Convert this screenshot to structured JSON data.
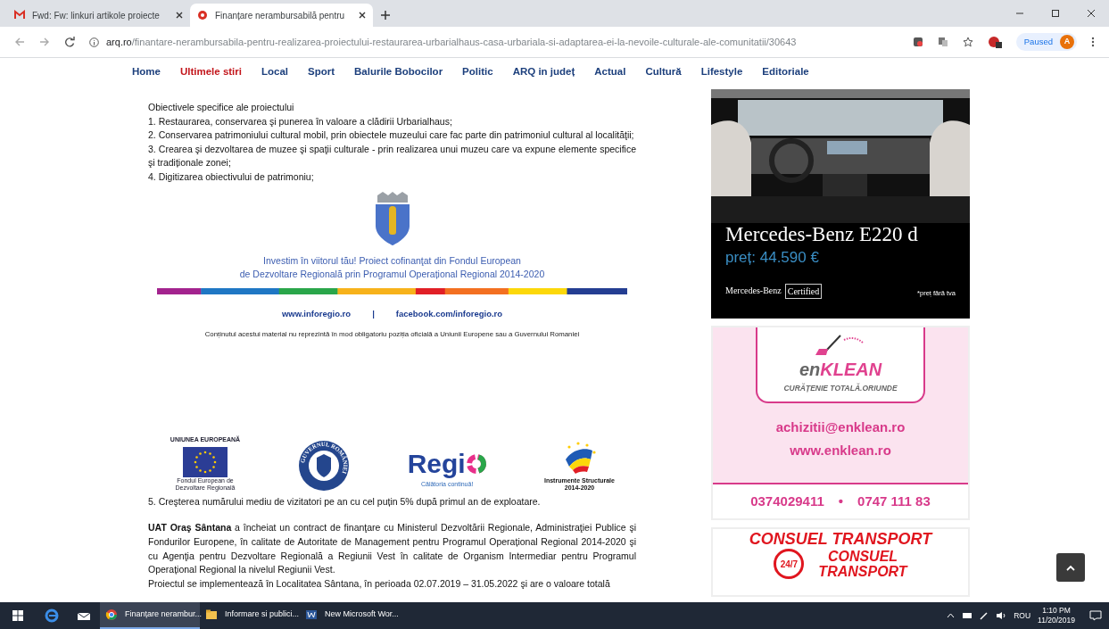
{
  "browser": {
    "tabs": [
      {
        "title": "Fwd: Fw: linkuri artikole proiecte",
        "kind": "mail",
        "selected": false
      },
      {
        "title": "Finanțare nerambursabilă pentru",
        "kind": "site",
        "selected": true
      }
    ],
    "url_host": "arq.ro",
    "url_path": "/finantare-nerambursabila-pentru-realizarea-proiectului-restaurarea-urbarialhaus-casa-urbariala-si-adaptarea-ei-la-nevoile-culturale-ale-comunitatii/30643",
    "profile_status": "Paused",
    "avatar_letter": "A"
  },
  "nav": [
    {
      "label": "Home",
      "selected": false
    },
    {
      "label": "Ultimele stiri",
      "selected": true
    },
    {
      "label": "Local",
      "selected": false
    },
    {
      "label": "Sport",
      "selected": false
    },
    {
      "label": "Balurile Bobocilor",
      "selected": false
    },
    {
      "label": "Politic",
      "selected": false
    },
    {
      "label": "ARQ in județ",
      "selected": false
    },
    {
      "label": "Actual",
      "selected": false
    },
    {
      "label": "Cultură",
      "selected": false
    },
    {
      "label": "Lifestyle",
      "selected": false
    },
    {
      "label": "Editoriale",
      "selected": false
    }
  ],
  "article": {
    "objectives_heading": "Obiectivele specifice ale proiectului",
    "objectives": [
      "1. Restaurarea, conservarea şi punerea în valoare a clădirii Urbarialhaus;",
      "2. Conservarea patrimoniului cultural mobil, prin obiectele muzeului care fac parte din patrimoniul cultural al localităţii;",
      "3. Crearea şi dezvoltarea de muzee şi spaţii culturale - prin realizarea unui muzeu care va expune elemente specifice şi tradiționale zonei;",
      "4. Digitizarea obiectivului de patrimoniu;"
    ],
    "banner": {
      "lines": [
        "Investim în viitorul tău! Proiect cofinanţat din Fondul European",
        "de Dezvoltare Regională prin Programul Operațional Regional 2014-2020"
      ],
      "links": [
        "www.inforegio.ro",
        "facebook.com/inforegio.ro"
      ],
      "separator": "|",
      "disclaimer": "Conținutul acestui material nu reprezintă în mod obligatoriu poziția oficială a Uniunii Europene sau a Guvernului Romaniei"
    },
    "logos": {
      "eu_top": "UNIUNEA EUROPEANĂ",
      "eu_bottom": "Fondul European de Dezvoltare Regională",
      "gov_ring": "GUVERNUL ROMÂNIEI",
      "regio": "Regi",
      "regio_tagline": "Călătoria continuă!",
      "is_title": "Instrumente Structurale",
      "is_years": "2014-2020"
    },
    "item5": "5. Creşterea numărului mediu de vizitatori pe an cu cel puțin 5% după primul an de exploatare.",
    "paragraphs": [
      "**UAT Oraş Sântana** a încheiat un contract de finanţare cu Ministerul Dezvoltării Regionale, Administraţiei Publice şi Fondurilor Europene, în calitate de Autoritate de Management pentru Programul Operațional Regional 2014-2020 şi cu Agenţia pentru Dezvoltare Regională a Regiunii Vest în calitate de Organism Intermediar pentru Programul Operațional Regional la nivelul Regiunii Vest.",
      "Proiectul se implementează în Localitatea Sântana, în perioada 02.07.2019 – 31.05.2022 şi are o valoare totală"
    ]
  },
  "ads": {
    "car": {
      "model": "Mercedes-Benz E220 d",
      "price": "preț: 44.590 €",
      "brand": "Mercedes-Benz",
      "brand_tag": "Certified",
      "note": "*preț fără tva"
    },
    "cleaning": {
      "logo_parts": [
        "en",
        "KLEAN"
      ],
      "tagline": "CURĂȚENIE TOTALĂ.ORIUNDE",
      "email": "achizitii@enklean.ro",
      "web": "www.enklean.ro",
      "phones": [
        "0374029411",
        "0747 111 83"
      ],
      "separator": "•"
    },
    "transport": {
      "heading": "CONSUEL TRANSPORT",
      "badge": "24/7",
      "lines": [
        "CONSUEL",
        "TRANSPORT"
      ]
    }
  },
  "taskbar": {
    "apps": [
      {
        "label": "Finanțare nerambur...",
        "kind": "chrome",
        "selected": true
      },
      {
        "label": "Informare si publici...",
        "kind": "folder",
        "selected": false
      },
      {
        "label": "New Microsoft Wor...",
        "kind": "word",
        "selected": false
      }
    ],
    "language": "ROU",
    "time": "1:10 PM",
    "date": "11/20/2019"
  }
}
